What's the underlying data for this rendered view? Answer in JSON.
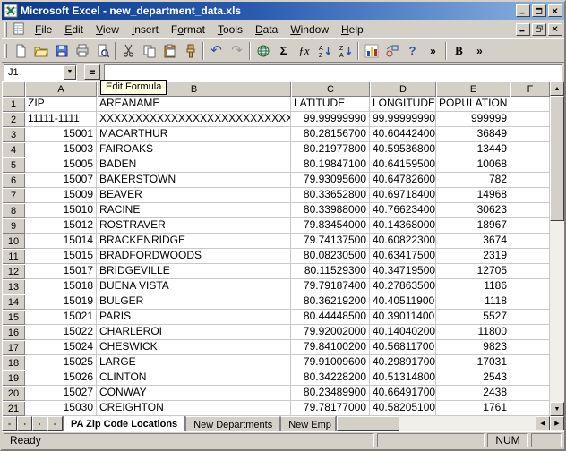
{
  "window": {
    "title": "Microsoft Excel - new_department_data.xls"
  },
  "colors": {
    "titlebar_start": "#0b3a8c",
    "titlebar_end": "#8cb4e2",
    "face": "#d4d0c8",
    "gridline": "#c9c9c9",
    "tooltip_bg": "#ffffe1"
  },
  "menu": {
    "items": [
      {
        "label": "File",
        "u": 0
      },
      {
        "label": "Edit",
        "u": 0
      },
      {
        "label": "View",
        "u": 0
      },
      {
        "label": "Insert",
        "u": 0
      },
      {
        "label": "Format",
        "u": 1
      },
      {
        "label": "Tools",
        "u": 0
      },
      {
        "label": "Data",
        "u": 0
      },
      {
        "label": "Window",
        "u": 0
      },
      {
        "label": "Help",
        "u": 0
      }
    ]
  },
  "toolbar": {
    "items": [
      {
        "type": "button",
        "name": "new-workbook-icon"
      },
      {
        "type": "button",
        "name": "open-icon"
      },
      {
        "type": "button",
        "name": "save-icon"
      },
      {
        "type": "button",
        "name": "print-icon"
      },
      {
        "type": "button",
        "name": "print-preview-icon"
      },
      {
        "type": "sep"
      },
      {
        "type": "button",
        "name": "cut-icon"
      },
      {
        "type": "button",
        "name": "copy-icon"
      },
      {
        "type": "button",
        "name": "paste-icon"
      },
      {
        "type": "button",
        "name": "format-painter-icon"
      },
      {
        "type": "sep"
      },
      {
        "type": "button",
        "name": "undo-icon",
        "glyph": "↶"
      },
      {
        "type": "button",
        "name": "redo-icon",
        "glyph": "↷"
      },
      {
        "type": "sep"
      },
      {
        "type": "button",
        "name": "insert-hyperlink-icon"
      },
      {
        "type": "button",
        "name": "autosum-icon",
        "glyph": "Σ"
      },
      {
        "type": "button",
        "name": "paste-function-icon",
        "glyph": "ƒx"
      },
      {
        "type": "button",
        "name": "sort-ascending-icon"
      },
      {
        "type": "button",
        "name": "sort-descending-icon"
      },
      {
        "type": "sep"
      },
      {
        "type": "button",
        "name": "chart-wizard-icon"
      },
      {
        "type": "button",
        "name": "drawing-icon"
      },
      {
        "type": "button",
        "name": "help-icon",
        "glyph": "?"
      },
      {
        "type": "button",
        "name": "more-buttons-icon",
        "glyph": "»"
      },
      {
        "type": "sep"
      },
      {
        "type": "button",
        "name": "bold-button",
        "glyph": "B"
      },
      {
        "type": "button",
        "name": "more-buttons2-icon",
        "glyph": "»"
      }
    ]
  },
  "formula_bar": {
    "name_box": "J1",
    "equals": "="
  },
  "tooltip": {
    "text": "Edit Formula"
  },
  "grid": {
    "columns": [
      "A",
      "B",
      "C",
      "D",
      "E",
      "F"
    ],
    "rows": [
      {
        "n": "1",
        "cells": [
          "ZIP",
          "AREANAME",
          "LATITUDE",
          "LONGITUDE",
          "POPULATION",
          ""
        ]
      },
      {
        "n": "2",
        "cells": [
          "11111-1111",
          "XXXXXXXXXXXXXXXXXXXXXXXXXXXXXXXX",
          "99.99999990",
          "99.99999990",
          "999999",
          ""
        ]
      },
      {
        "n": "3",
        "cells": [
          "15001",
          "MACARTHUR",
          "80.28156700",
          "40.60442400",
          "36849",
          ""
        ]
      },
      {
        "n": "4",
        "cells": [
          "15003",
          "FAIROAKS",
          "80.21977800",
          "40.59536800",
          "13449",
          ""
        ]
      },
      {
        "n": "5",
        "cells": [
          "15005",
          "BADEN",
          "80.19847100",
          "40.64159500",
          "10068",
          ""
        ]
      },
      {
        "n": "6",
        "cells": [
          "15007",
          "BAKERSTOWN",
          "79.93095600",
          "40.64782600",
          "782",
          ""
        ]
      },
      {
        "n": "7",
        "cells": [
          "15009",
          "BEAVER",
          "80.33652800",
          "40.69718400",
          "14968",
          ""
        ]
      },
      {
        "n": "8",
        "cells": [
          "15010",
          "RACINE",
          "80.33988000",
          "40.76623400",
          "30623",
          ""
        ]
      },
      {
        "n": "9",
        "cells": [
          "15012",
          "ROSTRAVER",
          "79.83454000",
          "40.14368000",
          "18967",
          ""
        ]
      },
      {
        "n": "10",
        "cells": [
          "15014",
          "BRACKENRIDGE",
          "79.74137500",
          "40.60822300",
          "3674",
          ""
        ]
      },
      {
        "n": "11",
        "cells": [
          "15015",
          "BRADFORDWOODS",
          "80.08230500",
          "40.63417500",
          "2319",
          ""
        ]
      },
      {
        "n": "12",
        "cells": [
          "15017",
          "BRIDGEVILLE",
          "80.11529300",
          "40.34719500",
          "12705",
          ""
        ]
      },
      {
        "n": "13",
        "cells": [
          "15018",
          "BUENA VISTA",
          "79.79187400",
          "40.27863500",
          "1186",
          ""
        ]
      },
      {
        "n": "14",
        "cells": [
          "15019",
          "BULGER",
          "80.36219200",
          "40.40511900",
          "1118",
          ""
        ]
      },
      {
        "n": "15",
        "cells": [
          "15021",
          "PARIS",
          "80.44448500",
          "40.39011400",
          "5527",
          ""
        ]
      },
      {
        "n": "16",
        "cells": [
          "15022",
          "CHARLEROI",
          "79.92002000",
          "40.14040200",
          "11800",
          ""
        ]
      },
      {
        "n": "17",
        "cells": [
          "15024",
          "CHESWICK",
          "79.84100200",
          "40.56811700",
          "9823",
          ""
        ]
      },
      {
        "n": "18",
        "cells": [
          "15025",
          "LARGE",
          "79.91009600",
          "40.29891700",
          "17031",
          ""
        ]
      },
      {
        "n": "19",
        "cells": [
          "15026",
          "CLINTON",
          "80.34228200",
          "40.51314800",
          "2543",
          ""
        ]
      },
      {
        "n": "20",
        "cells": [
          "15027",
          "CONWAY",
          "80.23489900",
          "40.66491700",
          "2438",
          ""
        ]
      },
      {
        "n": "21",
        "cells": [
          "15030",
          "CREIGHTON",
          "79.78177000",
          "40.58205100",
          "1761",
          ""
        ]
      }
    ]
  },
  "sheet_tabs": {
    "nav": [
      {
        "name": "first-sheet-button",
        "icon": "tab-first-icon"
      },
      {
        "name": "prev-sheet-button",
        "icon": "tab-prev-icon"
      },
      {
        "name": "next-sheet-button",
        "icon": "tab-next-icon"
      },
      {
        "name": "last-sheet-button",
        "icon": "tab-last-icon"
      }
    ],
    "tabs": [
      {
        "label": "PA Zip Code Locations",
        "active": true
      },
      {
        "label": "New Departments",
        "active": false
      },
      {
        "label": "New Emp",
        "active": false
      }
    ]
  },
  "status": {
    "ready": "Ready",
    "num": "NUM"
  }
}
